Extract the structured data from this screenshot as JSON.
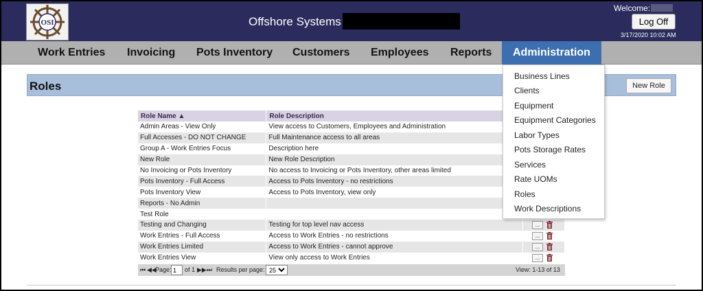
{
  "header": {
    "title": "Offshore Systems",
    "logo_text": "OSI",
    "welcome": "Welcome:",
    "logoff_label": "Log Off",
    "datetime": "3/17/2020 10:02 AM"
  },
  "nav": {
    "items": [
      "Work Entries",
      "Invoicing",
      "Pots Inventory",
      "Customers",
      "Employees",
      "Reports",
      "Administration"
    ],
    "active": "Administration"
  },
  "admin_menu": {
    "items": [
      "Business Lines",
      "Clients",
      "Equipment",
      "Equipment Categories",
      "Labor Types",
      "Pots Storage Rates",
      "Services",
      "Rate UOMs",
      "Roles",
      "Work Descriptions"
    ]
  },
  "page": {
    "title": "Roles",
    "new_role_label": "New Role"
  },
  "table": {
    "columns": [
      "Role Name ▲",
      "Role Description"
    ],
    "rows": [
      {
        "name": "Admin Areas - View Only",
        "description": "View access to Customers, Employees and Administration"
      },
      {
        "name": "Full Accesses - DO NOT CHANGE",
        "description": "Full Maintenance access to all areas"
      },
      {
        "name": "Group A - Work Entries Focus",
        "description": "Description here"
      },
      {
        "name": "New Role",
        "description": "New Role Description"
      },
      {
        "name": "No Invoicing or Pots Inventory",
        "description": "No access to Invoicing or Pots Inventory, other areas limited"
      },
      {
        "name": "Pots Inventory - Full Access",
        "description": "Access to Pots Inventory - no restrictions"
      },
      {
        "name": "Pots Inventory View",
        "description": "Access to Pots Inventory, view only"
      },
      {
        "name": "Reports - No Admin",
        "description": ""
      },
      {
        "name": "Test Role",
        "description": ""
      },
      {
        "name": "Testing and Changing",
        "description": "Testing for top level nav access"
      },
      {
        "name": "Work Entries - Full Access",
        "description": "Access to Work Entries - no restrictions"
      },
      {
        "name": "Work Entries Limited",
        "description": "Access to Work Entries - cannot approve"
      },
      {
        "name": "Work Entries View",
        "description": "View only access to Work Entries"
      }
    ],
    "action_label": "..."
  },
  "pager": {
    "page_label": "Page:",
    "page_value": "1",
    "of_label": "of 1",
    "results_label": "Results per page:",
    "per_page": "25",
    "view_label": "View: 1-13 of 13"
  },
  "colors": {
    "header_bg": "#2b2b5e",
    "nav_bg": "#b0b0b0",
    "nav_active": "#3d6fb0",
    "roles_bar": "#a8bfdb",
    "trash": "#7a1f2a"
  }
}
